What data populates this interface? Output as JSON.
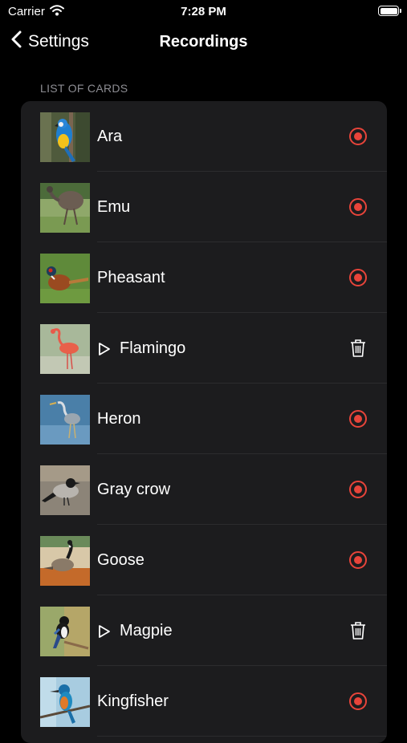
{
  "status_bar": {
    "carrier": "Carrier",
    "time": "7:28 PM"
  },
  "nav": {
    "back_label": "Settings",
    "title": "Recordings"
  },
  "section_header": "LIST OF CARDS",
  "colors": {
    "record": "#e8443a",
    "background": "#000000",
    "card": "#1c1c1e",
    "separator": "#2c2c2e",
    "secondary_text": "#8d8d93"
  },
  "cards": [
    {
      "name": "Ara",
      "has_recording": false,
      "action_icon": "record-icon"
    },
    {
      "name": "Emu",
      "has_recording": false,
      "action_icon": "record-icon"
    },
    {
      "name": "Pheasant",
      "has_recording": false,
      "action_icon": "record-icon"
    },
    {
      "name": "Flamingo",
      "has_recording": true,
      "action_icon": "trash-icon"
    },
    {
      "name": "Heron",
      "has_recording": false,
      "action_icon": "record-icon"
    },
    {
      "name": "Gray crow",
      "has_recording": false,
      "action_icon": "record-icon"
    },
    {
      "name": "Goose",
      "has_recording": false,
      "action_icon": "record-icon"
    },
    {
      "name": "Magpie",
      "has_recording": true,
      "action_icon": "trash-icon"
    },
    {
      "name": "Kingfisher",
      "has_recording": false,
      "action_icon": "record-icon"
    }
  ]
}
